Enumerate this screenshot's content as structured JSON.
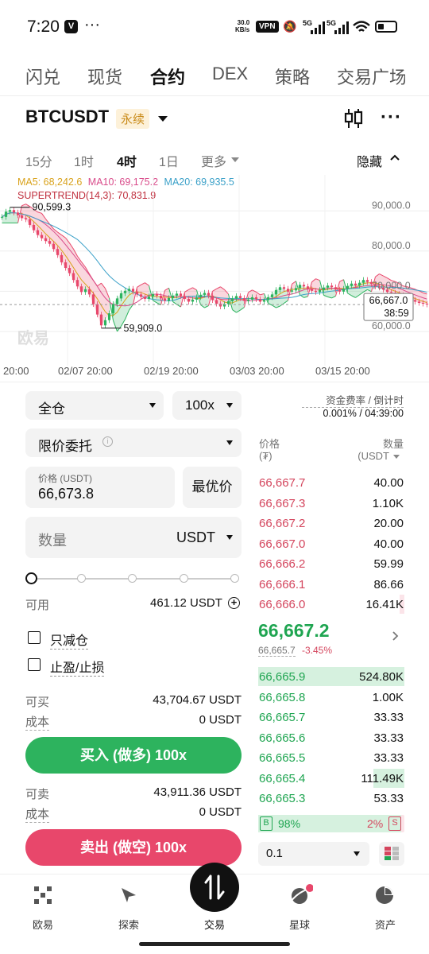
{
  "status_bar": {
    "time": "7:20",
    "more": "···",
    "speed_value": "30.0",
    "speed_unit": "KB/s",
    "vpn": "VPN",
    "net1": "5G",
    "net2": "5G"
  },
  "top_tabs": [
    "闪兑",
    "现货",
    "合约",
    "DEX",
    "策略",
    "交易广场"
  ],
  "active_tab": "合约",
  "header": {
    "symbol": "BTCUSDT",
    "contract_type": "永续"
  },
  "intervals": {
    "items": [
      "15分",
      "1时",
      "4时",
      "1日",
      "更多"
    ],
    "active": "4时",
    "hide_label": "隐藏"
  },
  "chart_data": {
    "type": "candlestick",
    "indicators": {
      "ma5": "MA5: 68,242.6",
      "ma10": "MA10: 69,175.2",
      "ma20": "MA20: 69,935.5",
      "supertrend": "SUPERTREND(14,3): 70,831.9"
    },
    "high_label": "90,599.3",
    "low_label": "59,909.0",
    "y_ticks": [
      "90,000.0",
      "80,000.0",
      "70,000.0",
      "60,000.0"
    ],
    "x_ticks": [
      "20:00",
      "02/07 20:00",
      "02/19 20:00",
      "03/03 20:00",
      "03/15 20:00"
    ],
    "last_price": "66,667.0",
    "countdown": "38:59",
    "watermark": "欧易",
    "close_series": [
      88500,
      89800,
      90200,
      89600,
      88900,
      88200,
      87900,
      86500,
      85200,
      84000,
      83200,
      82500,
      81800,
      80500,
      79000,
      77200,
      75800,
      74500,
      72800,
      71200,
      69800,
      70500,
      69200,
      66800,
      64200,
      61500,
      62800,
      64500,
      66800,
      68200,
      69500,
      70100,
      70600,
      69900,
      69200,
      68600,
      68100,
      68700,
      69300,
      68900,
      68200,
      67600,
      68300,
      68900,
      69400,
      68800,
      68100,
      67400,
      67900,
      68500,
      69100,
      69600,
      68900,
      67800,
      66900,
      66200,
      66800,
      67500,
      68200,
      68800,
      68300,
      67600,
      67900,
      68500,
      68000,
      67400,
      67800,
      68500,
      69200,
      70300,
      71000,
      70600,
      69900,
      70200,
      70800,
      71600,
      71200,
      70500,
      70100,
      69800,
      70300,
      70900,
      71400,
      71000,
      70400,
      69900,
      70600,
      71300,
      71900,
      71400,
      72100,
      72800,
      72300,
      71800,
      71200,
      70900,
      70400,
      69800,
      69600,
      69300,
      69000,
      68600,
      68100,
      67800,
      67400,
      67100,
      66900,
      66700
    ]
  },
  "funding": {
    "label": "资金费率 / 倒计时",
    "value": "0.001% / 04:39:00"
  },
  "order_form": {
    "margin_mode": "全仓",
    "leverage": "100x",
    "order_type": "限价委托",
    "price_label": "价格 (USDT)",
    "price_value": "66,673.8",
    "best_price": "最优价",
    "qty_placeholder": "数量",
    "qty_unit": "USDT",
    "slider_level": 0,
    "available_label": "可用",
    "available_value": "461.12 USDT",
    "reduce_only": "只减仓",
    "tp_sl": "止盈/止损",
    "can_buy_label": "可买",
    "can_buy_value": "43,704.67 USDT",
    "cost_label": "成本",
    "cost_buy_value": "0 USDT",
    "buy_button": "买入 (做多) 100x",
    "can_sell_label": "可卖",
    "can_sell_value": "43,911.36 USDT",
    "cost_sell_value": "0 USDT",
    "sell_button": "卖出 (做空) 100x"
  },
  "orderbook": {
    "price_header": "价格",
    "price_unit": "(₮)",
    "qty_header": "数量",
    "qty_unit": "(USDT",
    "asks": [
      {
        "price": "66,667.7",
        "qty": "40.00",
        "depth": 0.0
      },
      {
        "price": "66,667.3",
        "qty": "1.10K",
        "depth": 0.0
      },
      {
        "price": "66,667.2",
        "qty": "20.00",
        "depth": 0.0
      },
      {
        "price": "66,667.0",
        "qty": "40.00",
        "depth": 0.0
      },
      {
        "price": "66,666.2",
        "qty": "59.99",
        "depth": 0.0
      },
      {
        "price": "66,666.1",
        "qty": "86.66",
        "depth": 0.0
      },
      {
        "price": "66,666.0",
        "qty": "16.41K",
        "depth": 0.03
      }
    ],
    "last_price": "66,667.2",
    "mark_price": "66,665.7",
    "change": "-3.45%",
    "bids": [
      {
        "price": "66,665.9",
        "qty": "524.80K",
        "depth": 1.0
      },
      {
        "price": "66,665.8",
        "qty": "1.00K",
        "depth": 0.0
      },
      {
        "price": "66,665.7",
        "qty": "33.33",
        "depth": 0.0
      },
      {
        "price": "66,665.6",
        "qty": "33.33",
        "depth": 0.0
      },
      {
        "price": "66,665.5",
        "qty": "33.33",
        "depth": 0.0
      },
      {
        "price": "66,665.4",
        "qty": "111.49K",
        "depth": 0.21
      },
      {
        "price": "66,665.3",
        "qty": "53.33",
        "depth": 0.0
      }
    ],
    "buy_ratio_tag": "B",
    "buy_ratio": "98%",
    "sell_ratio": "2%",
    "sell_ratio_tag": "S",
    "buy_fraction": 0.98,
    "precision": "0.1"
  },
  "bottom_nav": [
    "欧易",
    "探索",
    "交易",
    "星球",
    "资产"
  ],
  "colors": {
    "green": "#2db35e",
    "red": "#e8476b",
    "ask": "#d4455d",
    "bid": "#1fa551"
  }
}
